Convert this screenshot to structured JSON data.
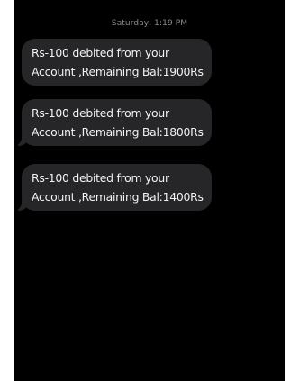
{
  "conversation": {
    "timestamp": "Saturday, 1:19 PM",
    "messages": [
      {
        "text": "Rs-100 debited from your\nAccount ,Remaining Bal:1900Rs"
      },
      {
        "text": "Rs-100 debited from your\nAccount ,Remaining Bal:1800Rs"
      },
      {
        "text": "Rs-100 debited from your\nAccount ,Remaining Bal:1400Rs"
      }
    ]
  },
  "colors": {
    "background": "#000000",
    "bubble": "#262629",
    "message_text": "#f2f2f2",
    "timestamp_text": "#8e8e93"
  }
}
